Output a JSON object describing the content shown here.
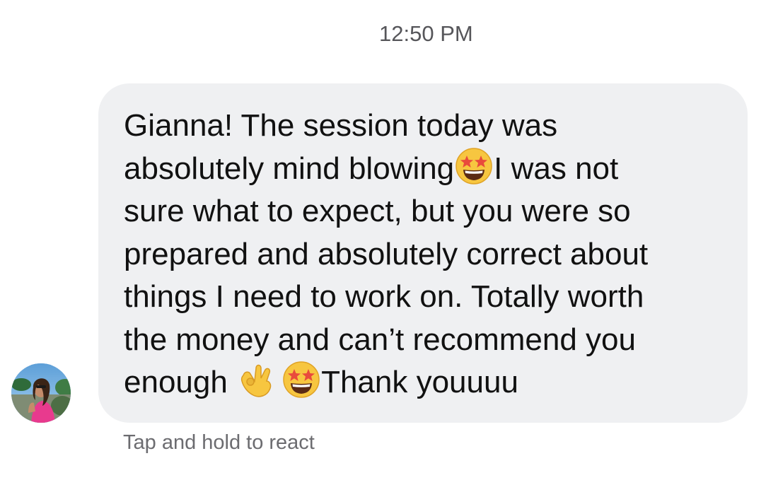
{
  "header": {
    "timestamp": "12:50 PM"
  },
  "message": {
    "sender_avatar_icon": "profile-photo-avatar",
    "lines": [
      [
        "Gianna! The session today was"
      ],
      [
        "absolutely mind blowing",
        "I was not"
      ],
      [
        "sure what to expect, but you were so"
      ],
      [
        "prepared and absolutely correct about"
      ],
      [
        "things I need to work on. Totally worth"
      ],
      [
        "the money and can’t recommend you"
      ],
      [
        "enough ",
        "Thank youuuu"
      ]
    ],
    "emojis": [
      "star-struck-emoji",
      "ok-hand-emoji",
      "star-struck-emoji"
    ]
  },
  "footer": {
    "hint": "Tap and hold to react"
  },
  "colors": {
    "bubble_background": "#eff0f2",
    "text": "#111111",
    "secondary_text": "#6c6c70",
    "emoji_yellow": "#f7c640"
  }
}
